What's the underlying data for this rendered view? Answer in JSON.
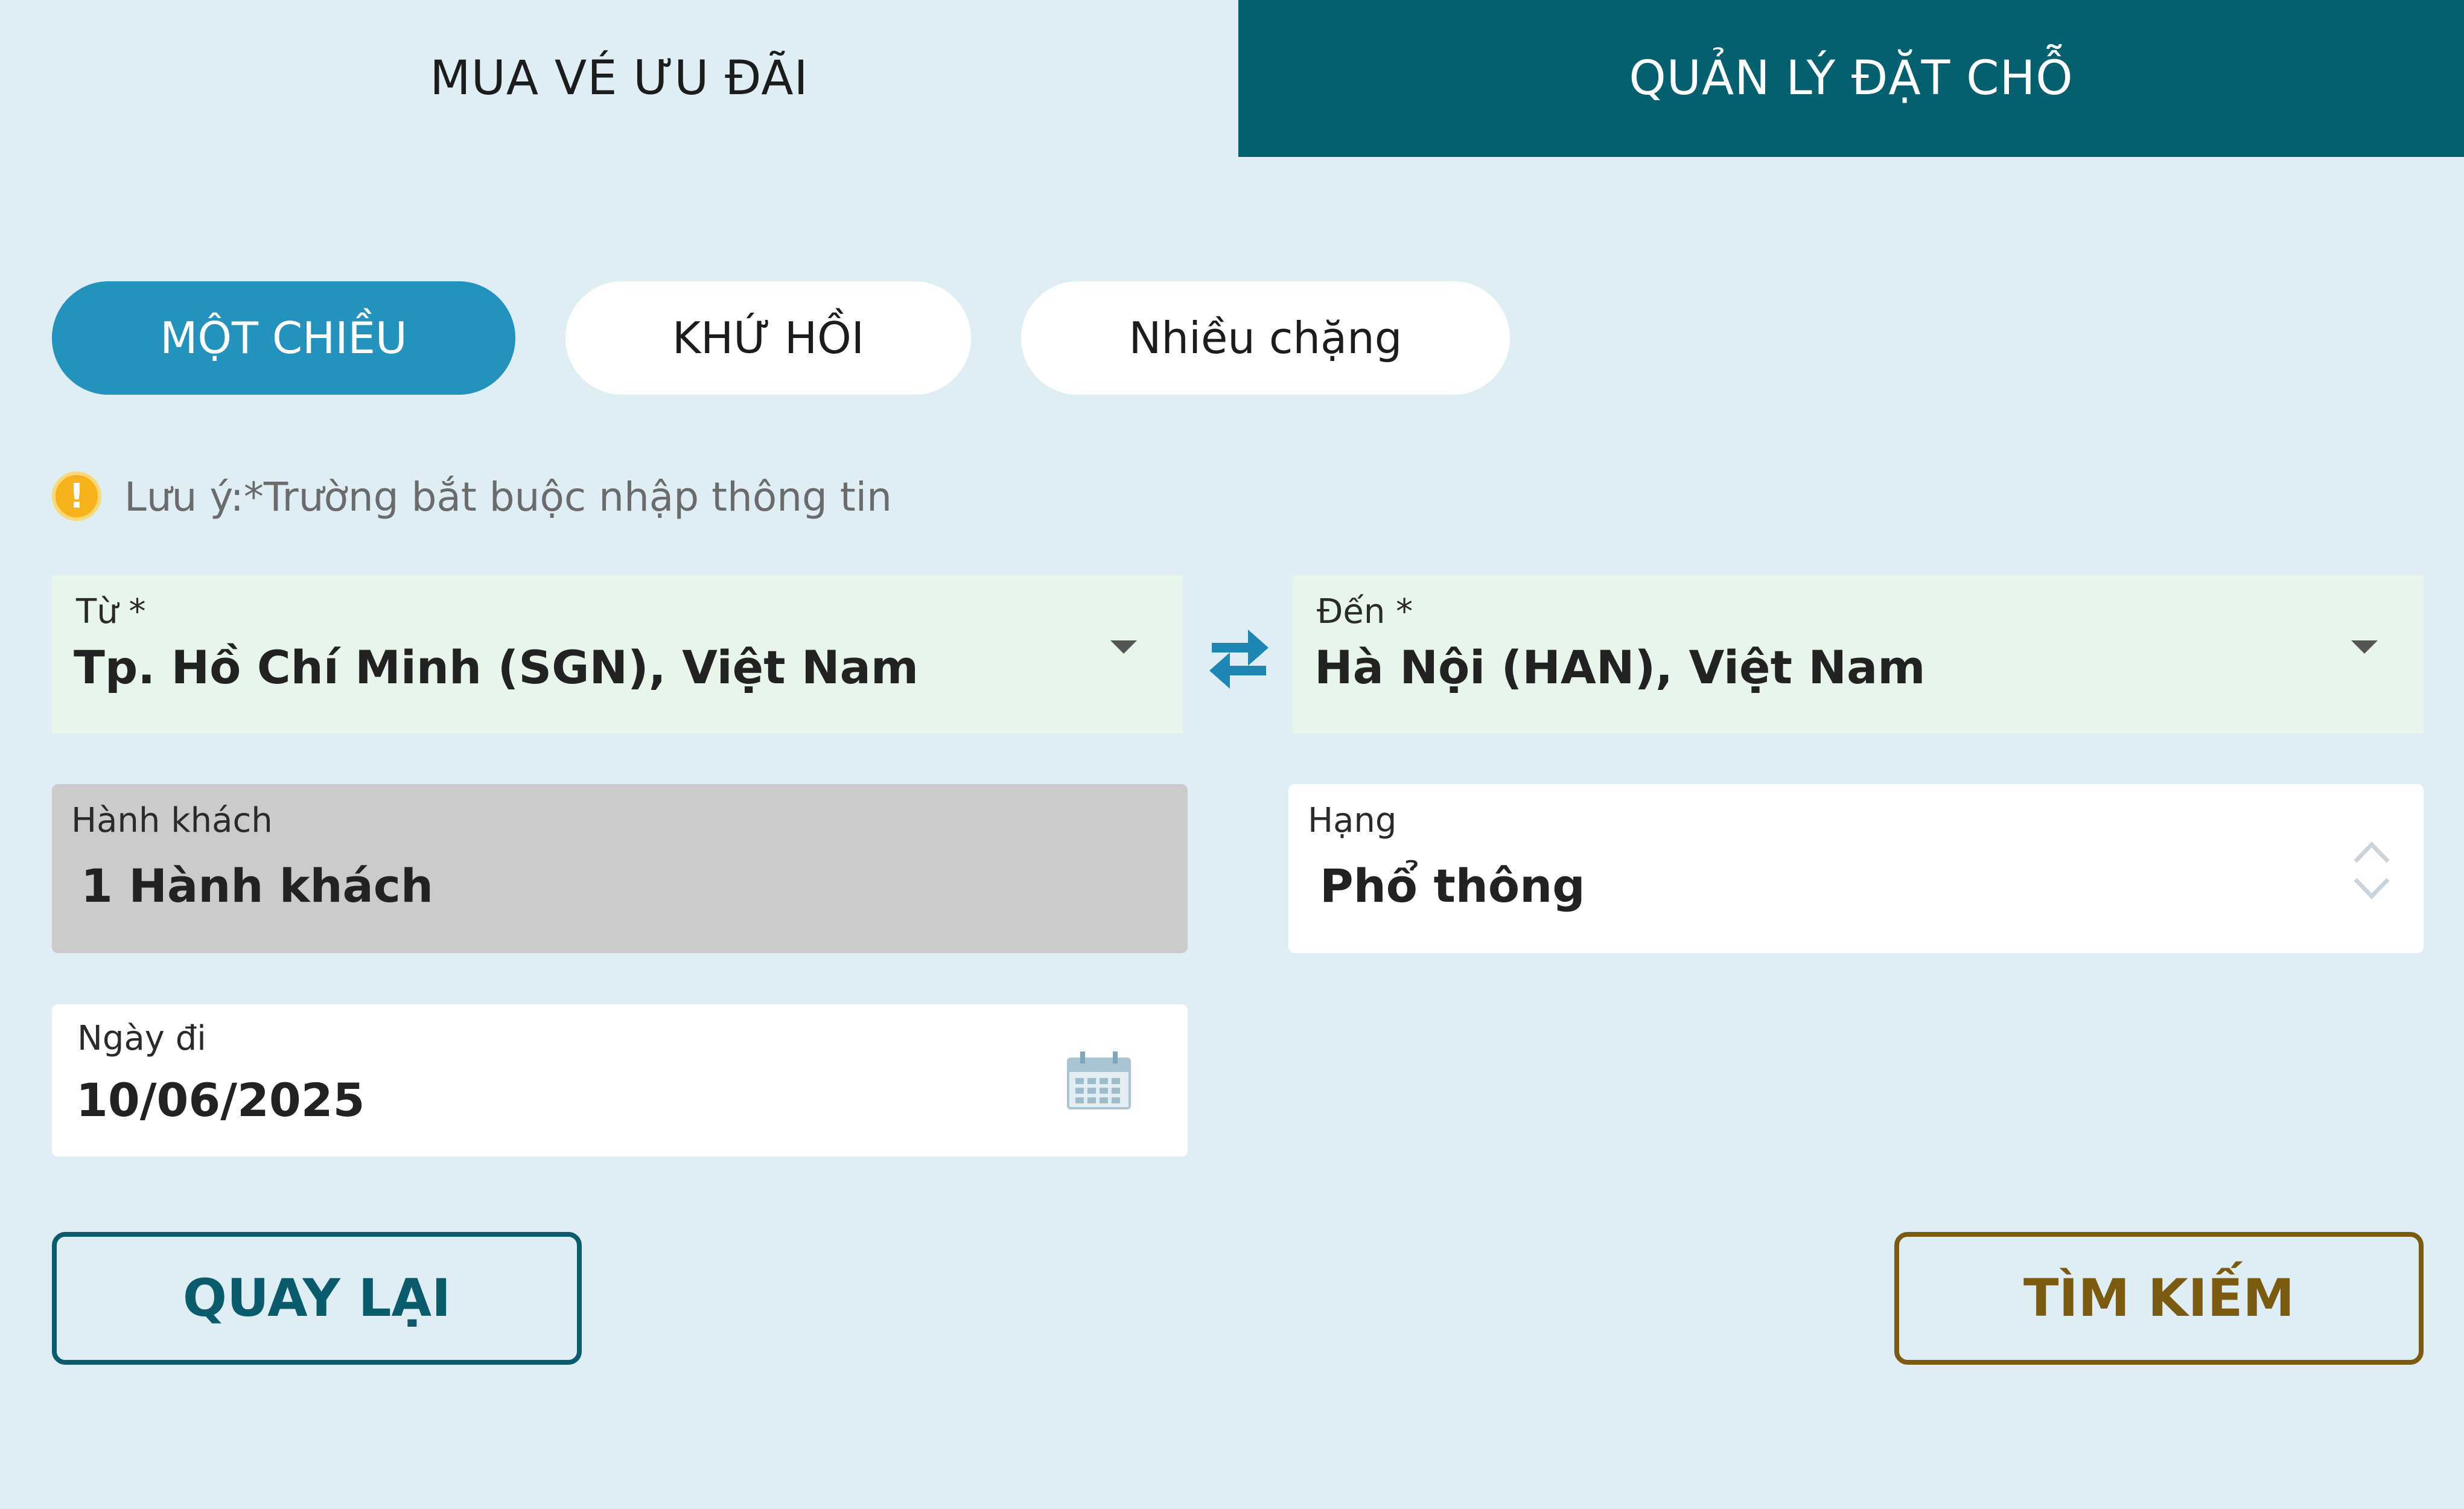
{
  "tabs": {
    "buy_label": "MUA VÉ ƯU ĐÃI",
    "manage_label": "QUẢN LÝ ĐẶT CHỖ"
  },
  "trip_types": {
    "one_way": "MỘT CHIỀU",
    "round_trip": "KHỨ HỒI",
    "multi_city": "Nhiều chặng",
    "selected": "MỘT CHIỀU"
  },
  "note": {
    "icon": "warning-icon",
    "text": "Lưu ý:*Trường bắt buộc nhập thông tin"
  },
  "from": {
    "label": "Từ *",
    "value": "Tp. Hồ Chí Minh (SGN), Việt Nam"
  },
  "to": {
    "label": "Đến *",
    "value": "Hà Nội (HAN), Việt Nam"
  },
  "passengers": {
    "label": "Hành khách",
    "value": "1 Hành khách"
  },
  "cabin_class": {
    "label": "Hạng",
    "value": "Phổ thông"
  },
  "departure_date": {
    "label": "Ngày đi",
    "value": "10/06/2025"
  },
  "buttons": {
    "back": "QUAY LẠI",
    "search": "TÌM KIẾM"
  },
  "colors": {
    "page_bg": "#dfeef5",
    "tab_active_bg": "#04606f",
    "pill_active_bg": "#2392bd",
    "field_bg": "#e8f5ea",
    "disabled_bg": "#cbcbcb",
    "back_button": "#0a5b6b",
    "search_button": "#7a5b10",
    "warning": "#f5b21a"
  }
}
